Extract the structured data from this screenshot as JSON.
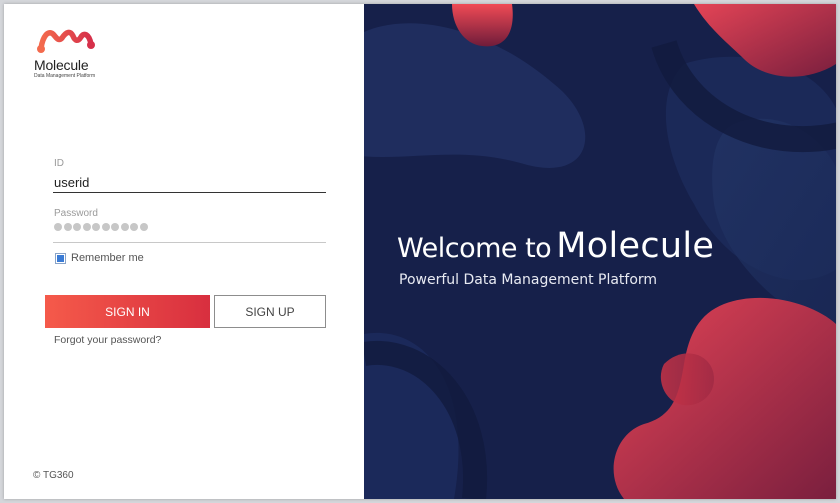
{
  "brand": {
    "name": "Molecule",
    "tagline_small": "Data Management Platform",
    "accent_color": "#e0334a",
    "navy_color": "#16204a"
  },
  "login": {
    "id_label": "ID",
    "id_value": "userid",
    "password_label": "Password",
    "password_masked_length": 10,
    "remember_label": "Remember me",
    "remember_checked": true,
    "signin_label": "SIGN IN",
    "signup_label": "SIGN UP",
    "forgot_label": "Forgot your password?"
  },
  "footer": {
    "copyright": "© TG360"
  },
  "hero": {
    "welcome_prefix": "Welcome to",
    "welcome_brand": "Molecule",
    "subtitle": "Powerful Data Management Platform"
  }
}
